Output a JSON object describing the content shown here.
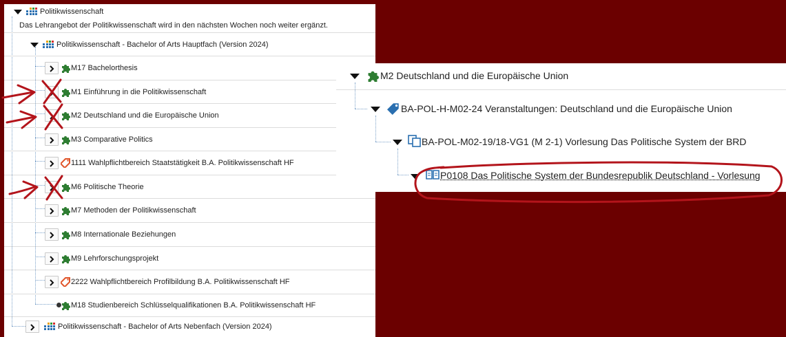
{
  "left_tree": {
    "root_label": "Politikwissenschaft",
    "root_description": "Das Lehrangebot der Politikwissenschaft wird in den nächsten Wochen noch weiter ergänzt.",
    "program_hf": "Politikwissenschaft - Bachelor of Arts Hauptfach (Version 2024)",
    "modules": [
      {
        "label": "M17 Bachelorthesis",
        "icon": "puzzle-icon"
      },
      {
        "label": "M1 Einführung in die Politikwissenschaft",
        "icon": "puzzle-icon"
      },
      {
        "label": "M2 Deutschland und die Europäische Union",
        "icon": "puzzle-icon"
      },
      {
        "label": "M3 Comparative Politics",
        "icon": "puzzle-icon"
      },
      {
        "label": "1111 Wahlpflichtbereich Staatstätigkeit B.A. Politikwissenschaft HF",
        "icon": "tag-icon"
      },
      {
        "label": "M6 Politische Theorie",
        "icon": "puzzle-icon"
      },
      {
        "label": "M7 Methoden der Politikwissenschaft",
        "icon": "puzzle-icon"
      },
      {
        "label": "M8 Internationale Beziehungen",
        "icon": "puzzle-icon"
      },
      {
        "label": "M9 Lehrforschungsprojekt",
        "icon": "puzzle-icon"
      },
      {
        "label": "2222 Wahlpflichtbereich Profilbildung B.A. Politikwissenschaft HF",
        "icon": "tag-icon"
      },
      {
        "label": "M18 Studienbereich Schlüsselqualifikationen B.A. Politikwissenschaft HF",
        "icon": "puzzle-icon"
      }
    ],
    "program_nf": "Politikwissenschaft - Bachelor of Arts Nebenfach (Version 2024)"
  },
  "right_tree": {
    "module": "M2 Deutschland und die Europäische Union",
    "unit": "BA-POL-H-M02-24 Veranstaltungen: Deutschland und die Europäische Union",
    "group": "BA-POL-M02-19/18-VG1 (M 2-1) Vorlesung Das Politische System der BRD",
    "course": "P0108 Das Politische System der Bundesrepublik Deutschland - Vorlesung"
  },
  "colors": {
    "background": "#6b0000",
    "puzzle_green": "#2e7d32",
    "tag_orange": "#e0552a",
    "program_blue": "#2a6fb0",
    "annotation_red": "#b3141b"
  }
}
